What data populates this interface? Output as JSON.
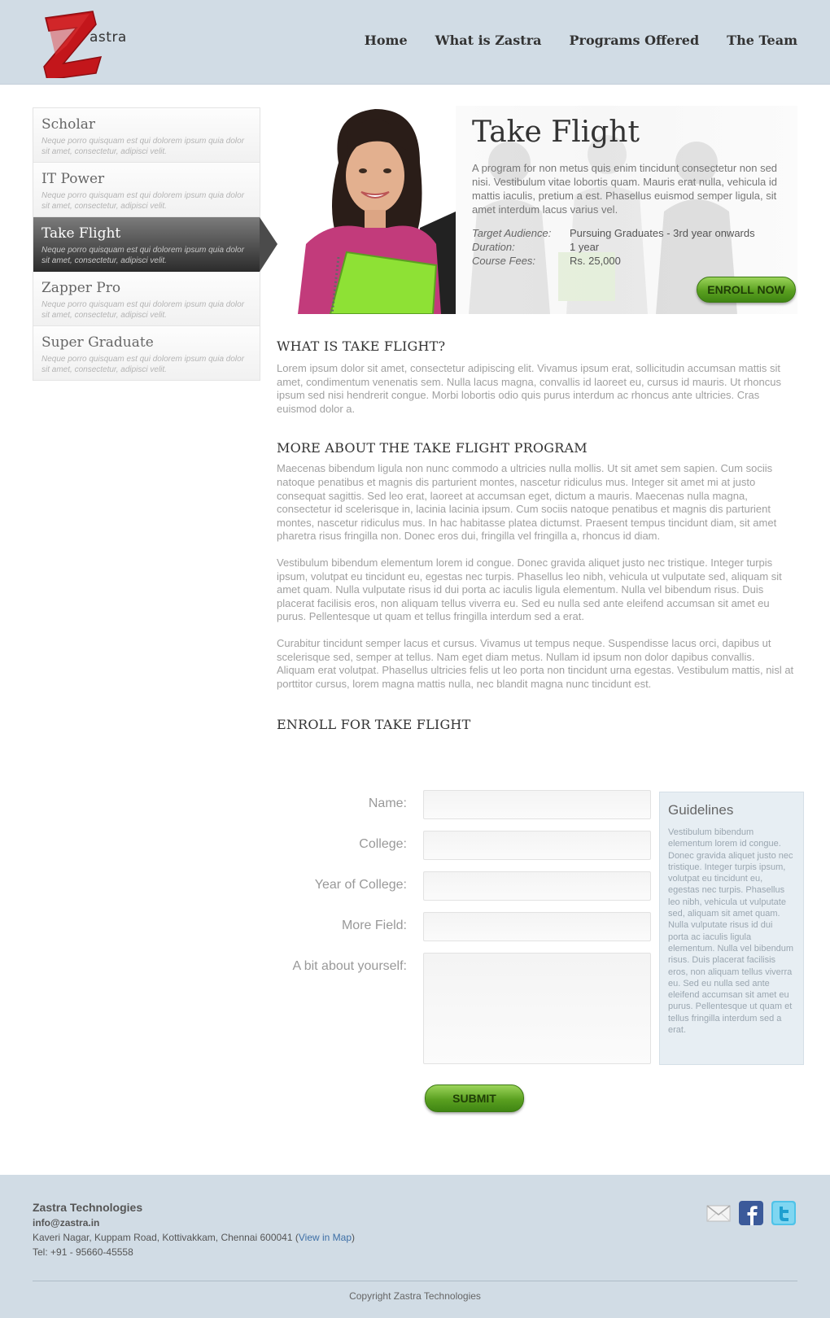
{
  "brand": {
    "logo_text": "astra"
  },
  "nav": [
    "Home",
    "What is Zastra",
    "Programs Offered",
    "The Team"
  ],
  "sidebar": {
    "items": [
      {
        "title": "Scholar",
        "desc": "Neque porro quisquam est qui dolorem ipsum quia dolor sit amet, consectetur, adipisci velit."
      },
      {
        "title": "IT Power",
        "desc": "Neque porro quisquam est qui dolorem ipsum quia dolor sit amet, consectetur, adipisci velit."
      },
      {
        "title": "Take Flight",
        "desc": "Neque porro quisquam est qui dolorem ipsum quia dolor sit amet, consectetur, adipisci velit."
      },
      {
        "title": "Zapper Pro",
        "desc": "Neque porro quisquam est qui dolorem ipsum quia dolor sit amet, consectetur, adipisci velit."
      },
      {
        "title": "Super Graduate",
        "desc": "Neque porro quisquam est qui dolorem ipsum quia dolor sit amet, consectetur, adipisci velit."
      }
    ]
  },
  "hero": {
    "title": "Take Flight",
    "desc": "A program for non metus quis enim tincidunt consectetur non sed nisi. Vestibulum vitae lobortis quam. Mauris erat nulla, vehicula id mattis iaculis, pretium a est. Phasellus euismod semper ligula, sit amet interdum lacus varius vel.",
    "meta": [
      {
        "k": "Target Audience:",
        "v": "Pursuing Graduates - 3rd year onwards"
      },
      {
        "k": "Duration:",
        "v": "1 year"
      },
      {
        "k": "Course Fees:",
        "v": "Rs. 25,000"
      }
    ],
    "enroll_label": "ENROLL NOW"
  },
  "sections": {
    "what_title": "WHAT IS TAKE FLIGHT?",
    "what_text": "Lorem ipsum dolor sit amet, consectetur adipiscing elit. Vivamus ipsum erat, sollicitudin accumsan mattis sit amet, condimentum venenatis sem. Nulla lacus magna, convallis id laoreet eu, cursus id mauris. Ut rhoncus ipsum sed nisi hendrerit congue. Morbi lobortis odio quis purus interdum ac rhoncus ante ultricies. Cras euismod dolor a.",
    "more_title": "MORE ABOUT THE TAKE FLIGHT PROGRAM",
    "more_p1": "Maecenas bibendum ligula non nunc commodo a ultricies nulla mollis. Ut sit amet sem sapien. Cum sociis natoque penatibus et magnis dis parturient montes, nascetur ridiculus mus. Integer sit amet mi at justo consequat sagittis. Sed leo erat, laoreet at accumsan eget, dictum a mauris. Maecenas nulla magna, consectetur id scelerisque in, lacinia lacinia ipsum. Cum sociis natoque penatibus et magnis dis parturient montes, nascetur ridiculus mus. In hac habitasse platea dictumst. Praesent tempus tincidunt diam, sit amet pharetra risus fringilla non. Donec eros dui, fringilla vel fringilla a, rhoncus id diam.",
    "more_p2": "Vestibulum bibendum elementum lorem id congue. Donec gravida aliquet justo nec tristique. Integer turpis ipsum, volutpat eu tincidunt eu, egestas nec turpis. Phasellus leo nibh, vehicula ut vulputate sed, aliquam sit amet quam. Nulla vulputate risus id dui porta ac iaculis ligula elementum. Nulla vel bibendum risus. Duis placerat facilisis eros, non aliquam tellus viverra eu. Sed eu nulla sed ante eleifend accumsan sit amet eu purus. Pellentesque ut quam et tellus fringilla interdum sed a erat.",
    "more_p3": "Curabitur tincidunt semper lacus et cursus. Vivamus ut tempus neque. Suspendisse lacus orci, dapibus ut scelerisque sed, semper at tellus. Nam eget diam metus. Nullam id ipsum non dolor dapibus convallis. Aliquam erat volutpat. Phasellus ultricies felis ut leo porta non tincidunt urna egestas. Vestibulum mattis, nisl at porttitor cursus, lorem magna mattis nulla, nec blandit magna nunc tincidunt est.",
    "enroll_title": "ENROLL FOR TAKE FLIGHT"
  },
  "form": {
    "name_label": "Name:",
    "college_label": "College:",
    "year_label": "Year of College:",
    "more_label": "More Field:",
    "about_label": "A bit about yourself:",
    "submit_label": "SUBMIT"
  },
  "guidelines": {
    "title": "Guidelines",
    "text": "Vestibulum bibendum elementum lorem id congue. Donec gravida aliquet justo nec tristique. Integer turpis ipsum, volutpat eu tincidunt eu, egestas nec turpis. Phasellus leo nibh, vehicula ut vulputate sed, aliquam sit amet quam. Nulla vulputate risus id dui porta ac iaculis ligula elementum. Nulla vel bibendum risus. Duis placerat facilisis eros, non aliquam tellus viverra eu. Sed eu nulla sed ante eleifend accumsan sit amet eu purus. Pellentesque ut quam et tellus fringilla interdum sed a erat."
  },
  "footer": {
    "company": "Zastra Technologies",
    "email": "info@zastra.in",
    "address": "Kaveri Nagar, Kuppam Road, Kottivakkam, Chennai 600041 (",
    "map_link": "View in Map",
    "address_end": ")",
    "tel": "Tel: +91 - 95660-45558",
    "copyright": "Copyright Zastra Technologies"
  },
  "colors": {
    "header_bg": "#d1dce5",
    "accent_green": "#5aa020",
    "active_sidebar": "#3a3a3a",
    "logo_red": "#c3161b"
  },
  "icons": [
    "mail-icon",
    "facebook-icon",
    "twitter-icon"
  ]
}
